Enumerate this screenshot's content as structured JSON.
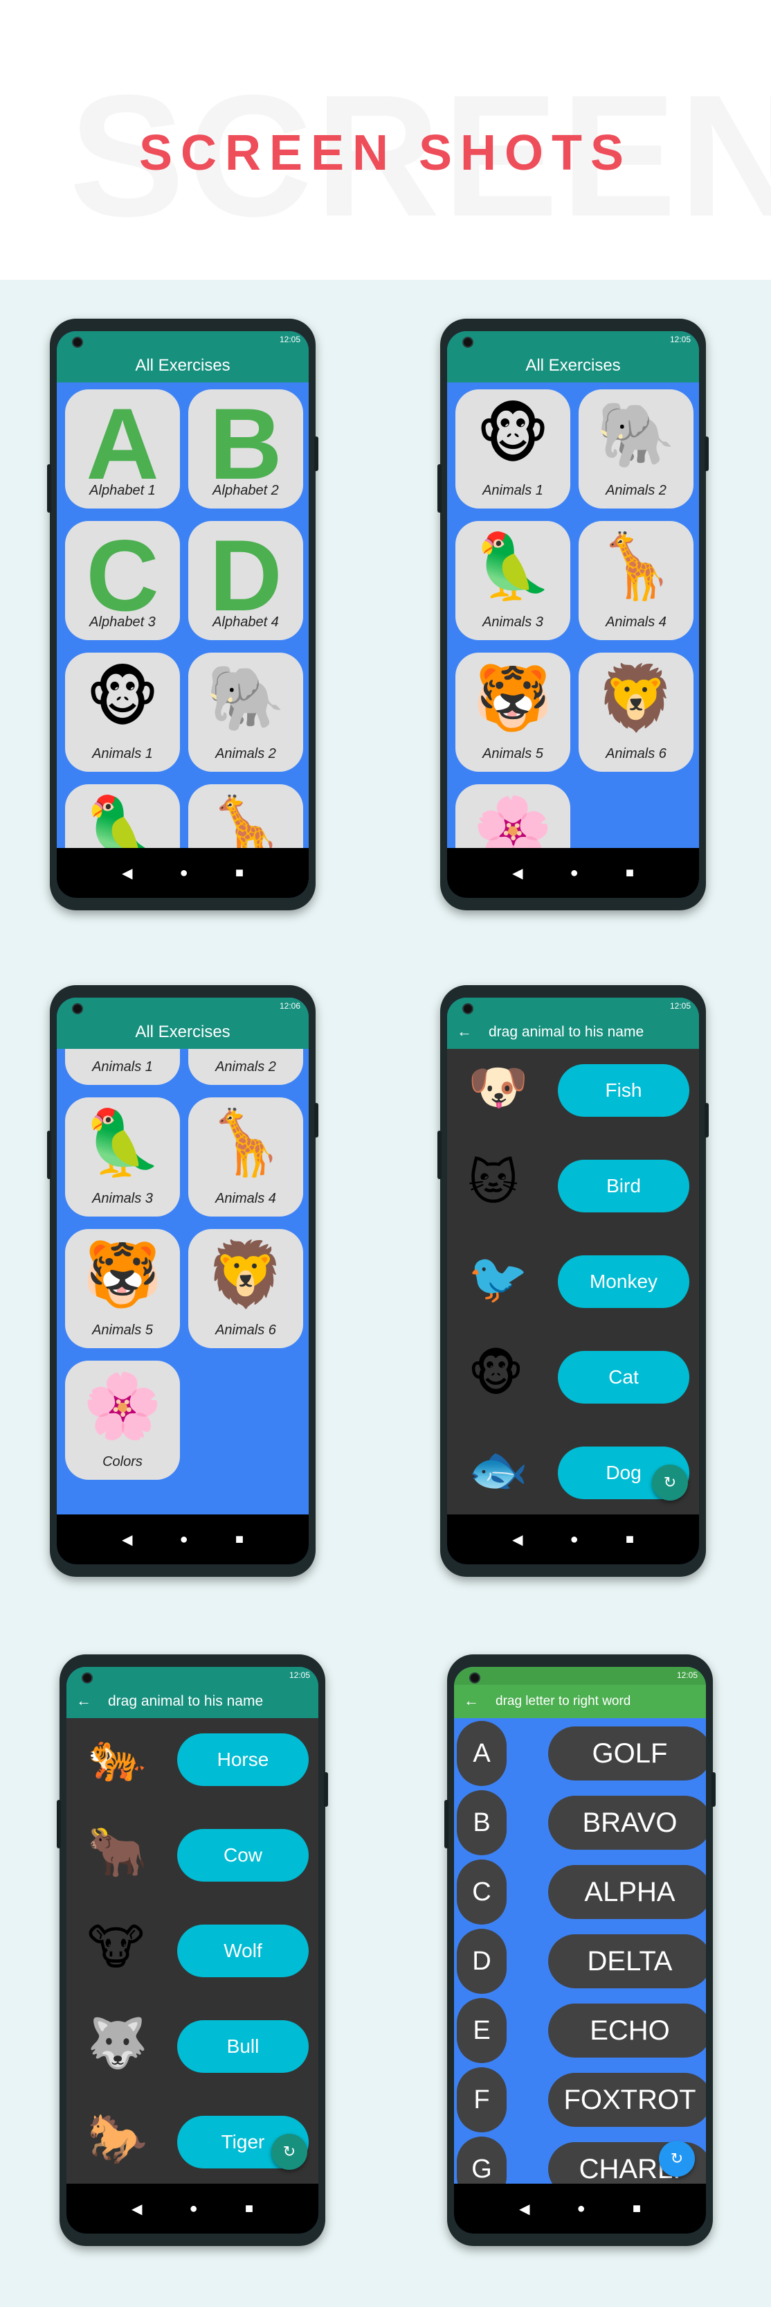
{
  "header": {
    "title": "SCREEN SHOTS",
    "background_text": "SCREEN"
  },
  "status": {
    "time1": "12:05",
    "time2": "12:06"
  },
  "appbar": {
    "all_exercises": "All Exercises",
    "drag_animal": "drag animal to his name",
    "drag_letter": "drag letter to right word"
  },
  "nav": {
    "back": "◀",
    "home": "●",
    "recent": "■"
  },
  "cards": {
    "alphabet1": "Alphabet 1",
    "alphabet2": "Alphabet 2",
    "alphabet3": "Alphabet 3",
    "alphabet4": "Alphabet 4",
    "animals1": "Animals 1",
    "animals2": "Animals 2",
    "animals3": "Animals 3",
    "animals4": "Animals 4",
    "animals5": "Animals 5",
    "animals6": "Animals 6",
    "colors": "Colors",
    "letterA": "A",
    "letterB": "B",
    "letterC": "C",
    "letterD": "D"
  },
  "match1": {
    "names": [
      "Fish",
      "Bird",
      "Monkey",
      "Cat",
      "Dog"
    ]
  },
  "match2": {
    "names": [
      "Horse",
      "Cow",
      "Wolf",
      "Bull",
      "Tiger"
    ]
  },
  "letters": {
    "letters": [
      "A",
      "B",
      "C",
      "D",
      "E",
      "F",
      "G"
    ],
    "words": [
      "GOLF",
      "BRAVO",
      "ALPHA",
      "DELTA",
      "ECHO",
      "FOXTROT",
      "CHARLI"
    ]
  },
  "icons": {
    "monkey": "🐵",
    "elephant": "🐘",
    "parrot": "🦜",
    "giraffe": "🦒",
    "tiger": "🐯",
    "lion": "🦁",
    "colors": "🌸",
    "dog": "🐶",
    "cat": "🐱",
    "bird": "🐦",
    "fish": "🐟",
    "tiger_full": "🐅",
    "cow": "🐮",
    "bull": "🐂",
    "wolf": "🐺",
    "horse": "🐎",
    "refresh": "↻",
    "back_arrow": "←"
  },
  "colors": {
    "accent": "#ee4d5a",
    "teal": "#17907e",
    "blue": "#3d82f5",
    "cyan": "#00bcd4",
    "green": "#4caf50"
  }
}
